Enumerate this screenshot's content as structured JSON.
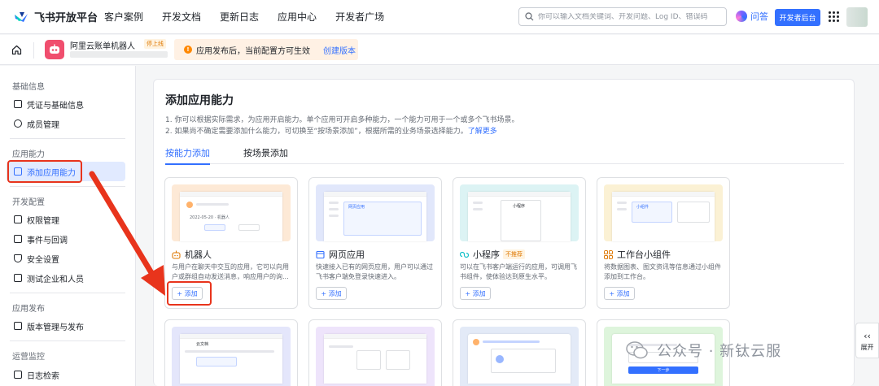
{
  "topbar": {
    "brand": "飞书开放平台",
    "nav": [
      "客户案例",
      "开发文档",
      "更新日志",
      "应用中心",
      "开发者广场"
    ],
    "search_placeholder": "你可以输入文档关键词、开发问题、Log ID、错误码",
    "ask_label": "问答",
    "dev_console_label": "开发者后台"
  },
  "app_header": {
    "app_name": "阿里云账单机器人",
    "status_badge": "停上线",
    "notice_text": "应用发布后，当前配置方可生效",
    "create_version_link": "创建版本"
  },
  "sidebar": {
    "groups": [
      {
        "title": "基础信息",
        "items": [
          "凭证与基础信息",
          "成员管理"
        ]
      },
      {
        "title": "应用能力",
        "items": [
          "添加应用能力"
        ]
      },
      {
        "title": "开发配置",
        "items": [
          "权限管理",
          "事件与回调",
          "安全设置",
          "测试企业和人员"
        ]
      },
      {
        "title": "应用发布",
        "items": [
          "版本管理与发布"
        ]
      },
      {
        "title": "运营监控",
        "items": [
          "日志检索"
        ]
      }
    ],
    "active_item": "添加应用能力"
  },
  "main": {
    "title": "添加应用能力",
    "desc_line1": "1. 你可以根据实际需求，为应用开启能力。单个应用可开启多种能力，一个能力可用于一个或多个飞书场景。",
    "desc_line2": "2. 如果尚不确定需要添加什么能力，可切换至“按场景添加”，根据所需的业务场景选择能力。",
    "learn_more": "了解更多",
    "tabs": [
      "按能力添加",
      "按场景添加"
    ],
    "active_tab": "按能力添加",
    "cards": [
      {
        "title": "机器人",
        "desc": "与用户在聊天中交互的应用，它可以向用户或群组自动发送消息，响应用户的询...",
        "add_label": "+ 添加",
        "icon": "robot-icon"
      },
      {
        "title": "网页应用",
        "desc": "快速接入已有的网页应用，用户可以通过飞书客户端免登录快速进入。",
        "add_label": "+ 添加",
        "icon": "web-app-icon"
      },
      {
        "title": "小程序",
        "tag": "不推荐",
        "desc": "可以在飞书客户端运行的应用，可调用飞书组件，使体验达到原生水平。",
        "add_label": "+ 添加",
        "icon": "mini-program-icon"
      },
      {
        "title": "工作台小组件",
        "desc": "将数据图表、图文资讯等信息通过小组件添加到工作台。",
        "add_label": "+ 添加",
        "icon": "widget-icon"
      }
    ],
    "preview_labels": {
      "bot_chat": "2022-05-20 · 机器人",
      "web_preview": "网页应用",
      "mini_preview": "小程序",
      "widget_preview": "小组件",
      "cloud_doc": "云文档",
      "next_btn": "下一步"
    }
  },
  "expand_label": "展开",
  "watermark_text": "公众号 · 新钛云服",
  "colors": {
    "accent": "#3370ff",
    "highlight": "#e8341c",
    "warning": "#ff8800"
  }
}
